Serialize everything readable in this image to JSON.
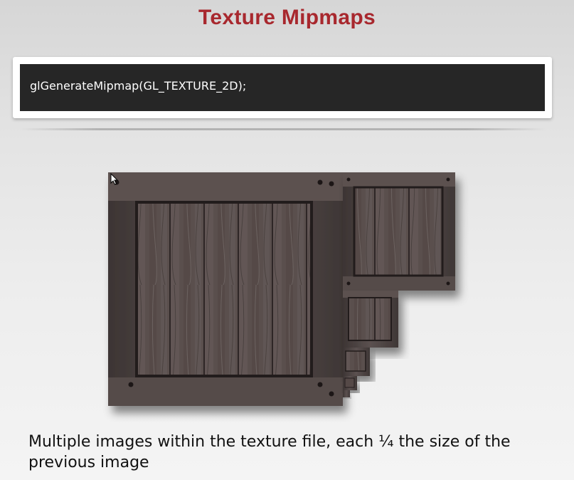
{
  "slide": {
    "title": "Texture Mipmaps",
    "code": "glGenerateMipmap(GL_TEXTURE_2D);",
    "caption": "Multiple images within the texture file, each ¼ the size of the previous image"
  },
  "figure": {
    "mipmap_levels": 6,
    "colors": {
      "title": "#a8282e",
      "code_background": "#262626",
      "wood_frame": "#4a4140",
      "wood_planks": "#5a4f4c"
    }
  },
  "icons": [
    "mouse-pointer-icon"
  ]
}
